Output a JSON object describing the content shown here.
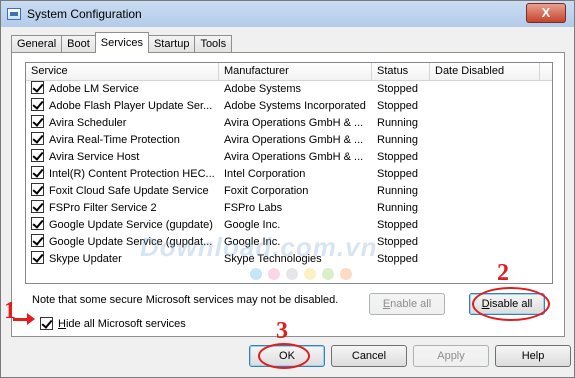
{
  "window": {
    "title": "System Configuration",
    "close_label": "X"
  },
  "tabs": [
    {
      "label": "General",
      "active": false
    },
    {
      "label": "Boot",
      "active": false
    },
    {
      "label": "Services",
      "active": true
    },
    {
      "label": "Startup",
      "active": false
    },
    {
      "label": "Tools",
      "active": false
    }
  ],
  "services": {
    "columns": [
      "Service",
      "Manufacturer",
      "Status",
      "Date Disabled"
    ],
    "rows": [
      {
        "checked": true,
        "service": "Adobe LM Service",
        "manufacturer": "Adobe Systems",
        "status": "Stopped",
        "date_disabled": ""
      },
      {
        "checked": true,
        "service": "Adobe Flash Player Update Ser...",
        "manufacturer": "Adobe Systems Incorporated",
        "status": "Stopped",
        "date_disabled": ""
      },
      {
        "checked": true,
        "service": "Avira Scheduler",
        "manufacturer": "Avira Operations GmbH & ...",
        "status": "Running",
        "date_disabled": ""
      },
      {
        "checked": true,
        "service": "Avira Real-Time Protection",
        "manufacturer": "Avira Operations GmbH & ...",
        "status": "Running",
        "date_disabled": ""
      },
      {
        "checked": true,
        "service": "Avira Service Host",
        "manufacturer": "Avira Operations GmbH & ...",
        "status": "Stopped",
        "date_disabled": ""
      },
      {
        "checked": true,
        "service": "Intel(R) Content Protection HEC...",
        "manufacturer": "Intel Corporation",
        "status": "Stopped",
        "date_disabled": ""
      },
      {
        "checked": true,
        "service": "Foxit Cloud Safe Update Service",
        "manufacturer": "Foxit Corporation",
        "status": "Running",
        "date_disabled": ""
      },
      {
        "checked": true,
        "service": "FSPro Filter Service 2",
        "manufacturer": "FSPro Labs",
        "status": "Running",
        "date_disabled": ""
      },
      {
        "checked": true,
        "service": "Google Update Service (gupdate)",
        "manufacturer": "Google Inc.",
        "status": "Stopped",
        "date_disabled": ""
      },
      {
        "checked": true,
        "service": "Google Update Service (gupdat...",
        "manufacturer": "Google Inc.",
        "status": "Stopped",
        "date_disabled": ""
      },
      {
        "checked": true,
        "service": "Skype Updater",
        "manufacturer": "Skype Technologies",
        "status": "Stopped",
        "date_disabled": ""
      }
    ]
  },
  "note": "Note that some secure Microsoft services may not be disabled.",
  "enable_all": {
    "label_u": "E",
    "label_rest": "nable all"
  },
  "disable_all": {
    "label_u": "D",
    "label_rest": "isable all"
  },
  "hide_microsoft": {
    "checked": true,
    "label_u": "H",
    "label_rest": "ide all Microsoft services"
  },
  "footer": {
    "ok_label": "OK",
    "cancel_label": "Cancel",
    "apply_label": "Apply",
    "help_label": "Help"
  },
  "annotations": {
    "n1": "1",
    "n2": "2",
    "n3": "3"
  },
  "watermark": {
    "text": "Download.com.vn"
  },
  "colors": {
    "annotation": "#e11d1d",
    "accent": "#3c7fb1"
  }
}
